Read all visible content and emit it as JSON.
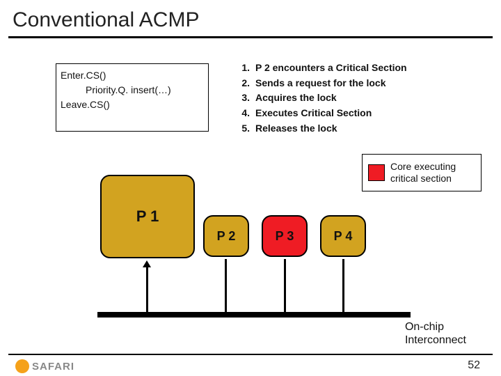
{
  "title": "Conventional ACMP",
  "code": {
    "line1": "Enter.CS()",
    "line2": "Priority.Q. insert(…)",
    "line3": "Leave.CS()"
  },
  "steps": [
    {
      "n": "1.",
      "text": "P 2 encounters a Critical Section"
    },
    {
      "n": "2.",
      "text": "Sends a request for the lock"
    },
    {
      "n": "3.",
      "text": "Acquires the lock"
    },
    {
      "n": "4.",
      "text": "Executes Critical Section"
    },
    {
      "n": "5.",
      "text": "Releases the lock"
    }
  ],
  "legend": {
    "text": "Core executing critical section",
    "swatch_color": "#ef1c24"
  },
  "processors": {
    "p1": "P 1",
    "p2": "P 2",
    "p3": "P 3",
    "p4": "P 4"
  },
  "interconnect": {
    "line1": "On-chip",
    "line2": "Interconnect"
  },
  "footer": {
    "logo": "SAFARI",
    "page": "52"
  }
}
